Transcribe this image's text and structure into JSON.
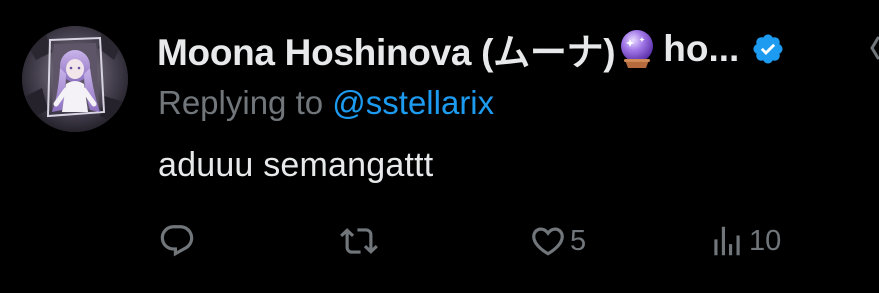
{
  "author": {
    "display_name": "Moona Hoshinova (ムーナ)",
    "handle_truncated": "ho...",
    "verified": true,
    "name_emoji": "crystal-ball-icon"
  },
  "reply_context": {
    "prefix": "Replying to",
    "mention": "@sstellarix"
  },
  "tweet": {
    "text": "aduuu semangattt"
  },
  "actions": {
    "reply_count": "",
    "retweet_count": "",
    "like_count": "5",
    "view_count": "10"
  },
  "colors": {
    "background": "#000000",
    "text": "#e7e9ea",
    "muted": "#71767b",
    "accent": "#1d9bf0"
  }
}
